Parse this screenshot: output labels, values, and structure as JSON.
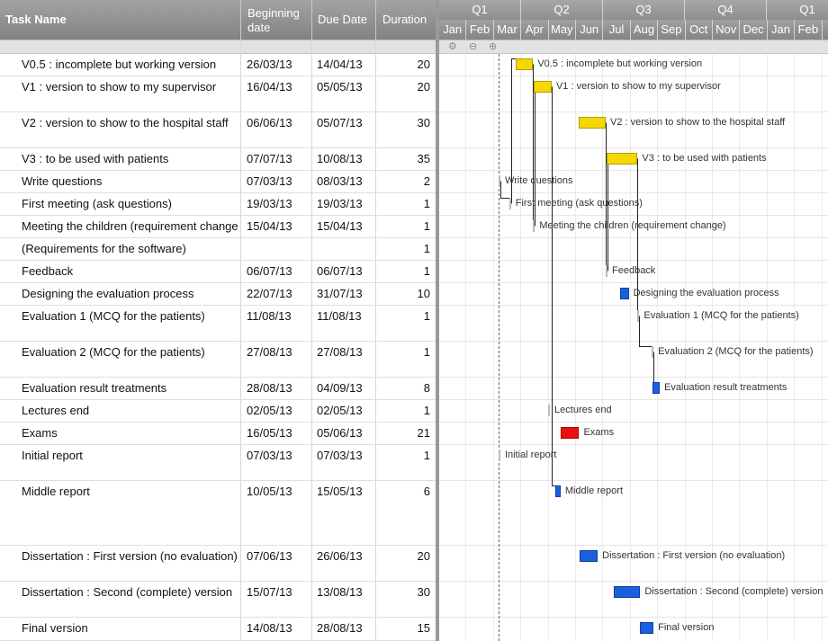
{
  "columns": {
    "task_name": "Task Name",
    "beginning_line1": "Beginning",
    "beginning_line2": "date",
    "due_date": "Due Date",
    "duration": "Duration"
  },
  "timeline": {
    "quarters": [
      "Q1",
      "Q2",
      "Q3",
      "Q4",
      "Q1"
    ],
    "months": [
      "Jan",
      "Feb",
      "Mar",
      "Apr",
      "May",
      "Jun",
      "Jul",
      "Aug",
      "Sep",
      "Oct",
      "Nov",
      "Dec",
      "Jan",
      "Feb",
      "M"
    ]
  },
  "toolbar_icons": [
    "gear-icon",
    "zoom-out-icon",
    "zoom-in-icon"
  ],
  "tasks": [
    {
      "name": "V0.5 : incomplete but working version",
      "begin": "26/03/13",
      "due": "14/04/13",
      "duration": "20",
      "label": "V0.5 : incomplete but working version",
      "color": "#f5d800"
    },
    {
      "name": "V1 : version to show to my supervisor",
      "begin": "16/04/13",
      "due": "05/05/13",
      "duration": "20",
      "label": "V1 : version to show to my supervisor",
      "color": "#f5d800"
    },
    {
      "name": "V2 : version to show to the hospital staff",
      "begin": "06/06/13",
      "due": "05/07/13",
      "duration": "30",
      "label": "V2 : version to show to the hospital staff",
      "color": "#f5d800"
    },
    {
      "name": "V3 : to be used with patients",
      "begin": "07/07/13",
      "due": "10/08/13",
      "duration": "35",
      "label": "V3 : to be used with patients",
      "color": "#f5d800"
    },
    {
      "name": "Write questions",
      "begin": "07/03/13",
      "due": "08/03/13",
      "duration": "2",
      "label": "Write questions",
      "color": "#1a5fe0"
    },
    {
      "name": "First meeting (ask questions)",
      "begin": "19/03/13",
      "due": "19/03/13",
      "duration": "1",
      "label": "First meeting (ask questions)",
      "color": "#1a5fe0"
    },
    {
      "name": "Meeting the children (requirement change)",
      "begin": "15/04/13",
      "due": "15/04/13",
      "duration": "1",
      "label": "Meeting the children (requirement change)",
      "color": "#1a5fe0"
    },
    {
      "name": "(Requirements for the software)",
      "begin": "",
      "due": "",
      "duration": "1",
      "label": "",
      "color": "#1a5fe0"
    },
    {
      "name": "Feedback",
      "begin": "06/07/13",
      "due": "06/07/13",
      "duration": "1",
      "label": "Feedback",
      "color": "#1a5fe0"
    },
    {
      "name": "Designing the evaluation process",
      "begin": "22/07/13",
      "due": "31/07/13",
      "duration": "10",
      "label": "Designing the evaluation process",
      "color": "#1a5fe0"
    },
    {
      "name": "Evaluation 1 (MCQ for the patients)",
      "begin": "11/08/13",
      "due": "11/08/13",
      "duration": "1",
      "label": "Evaluation 1 (MCQ for the patients)",
      "color": "#1a5fe0"
    },
    {
      "name": "Evaluation 2 (MCQ for the patients)",
      "begin": "27/08/13",
      "due": "27/08/13",
      "duration": "1",
      "label": "Evaluation 2 (MCQ for the patients)",
      "color": "#1a5fe0"
    },
    {
      "name": "Evaluation result treatments",
      "begin": "28/08/13",
      "due": "04/09/13",
      "duration": "8",
      "label": "Evaluation result treatments",
      "color": "#1a5fe0"
    },
    {
      "name": "Lectures end",
      "begin": "02/05/13",
      "due": "02/05/13",
      "duration": "1",
      "label": "Lectures end",
      "color": "#1a5fe0"
    },
    {
      "name": "Exams",
      "begin": "16/05/13",
      "due": "05/06/13",
      "duration": "21",
      "label": "Exams",
      "color": "#e81010"
    },
    {
      "name": "Initial report",
      "begin": "07/03/13",
      "due": "07/03/13",
      "duration": "1",
      "label": "Initial report",
      "color": "#1a5fe0"
    },
    {
      "name": "Middle report",
      "begin": "10/05/13",
      "due": "15/05/13",
      "duration": "6",
      "label": "Middle report",
      "color": "#1a5fe0"
    },
    {
      "name": "Dissertation : First version (no evaluation)",
      "begin": "07/06/13",
      "due": "26/06/13",
      "duration": "20",
      "label": "Dissertation : First version (no evaluation)",
      "color": "#1a5fe0"
    },
    {
      "name": "Dissertation : Second (complete) version",
      "begin": "15/07/13",
      "due": "13/08/13",
      "duration": "30",
      "label": "Dissertation : Second (complete) version",
      "color": "#1a5fe0"
    },
    {
      "name": "Final version",
      "begin": "14/08/13",
      "due": "28/08/13",
      "duration": "15",
      "label": "Final version",
      "color": "#1a5fe0"
    }
  ]
}
